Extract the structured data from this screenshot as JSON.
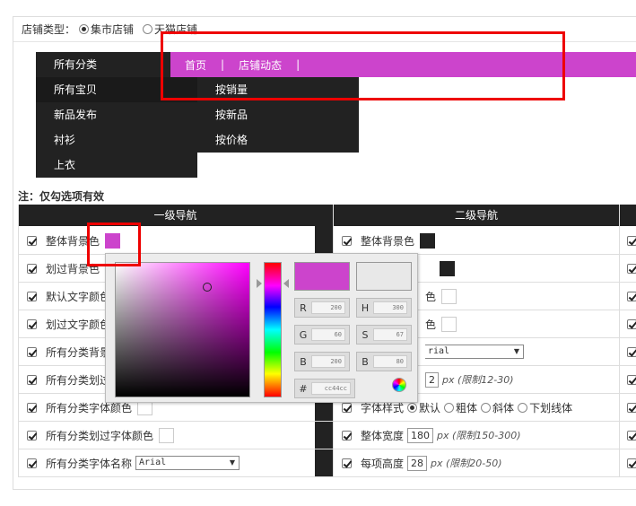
{
  "shop_type": {
    "label": "店铺类型：",
    "options": [
      {
        "label": "集市店铺",
        "selected": true
      },
      {
        "label": "天猫店铺",
        "selected": false
      }
    ]
  },
  "preview": {
    "categories": [
      "所有分类",
      "所有宝贝",
      "新品发布",
      "衬衫",
      "上衣"
    ],
    "top_nav": [
      "首页",
      "店铺动态"
    ],
    "top_nav_sep": "|",
    "sub_items": [
      "按销量",
      "按新品",
      "按价格"
    ],
    "accent_color": "#cc44cc"
  },
  "note": "注：仅勾选项有效",
  "table": {
    "headers": [
      "一级导航",
      "二级导航"
    ],
    "level1_rows": [
      "整体背景色",
      "划过背景色",
      "默认文字颜色",
      "划过文字颜色",
      "所有分类背景",
      "所有分类划过",
      "所有分类字体颜色",
      "所有分类划过字体颜色",
      "所有分类字体名称"
    ],
    "level1_font": "Arial",
    "level2_rows": {
      "bg": "整体背景色",
      "color_tail": "色",
      "font_tail": "rial",
      "size_value": "2",
      "size_hint": "px (限制12-30)",
      "style_label": "字体样式",
      "style_options": [
        "默认",
        "粗体",
        "斜体",
        "下划线体"
      ],
      "width_label": "整体宽度",
      "width_value": "180",
      "width_hint": "px (限制150-300)",
      "height_label": "每项高度",
      "height_value": "28",
      "height_hint": "px (限制20-50)"
    }
  },
  "color_picker": {
    "new_color": "#cc44cc",
    "old_color": "#e8e8e8",
    "fields": [
      {
        "label": "R",
        "value": "200"
      },
      {
        "label": "G",
        "value": "60"
      },
      {
        "label": "B",
        "value": "200"
      },
      {
        "label": "H",
        "value": "300"
      },
      {
        "label": "S",
        "value": "67"
      },
      {
        "label": "B",
        "value": "80"
      }
    ],
    "hex_label": "#",
    "hex_value": "cc44cc"
  }
}
